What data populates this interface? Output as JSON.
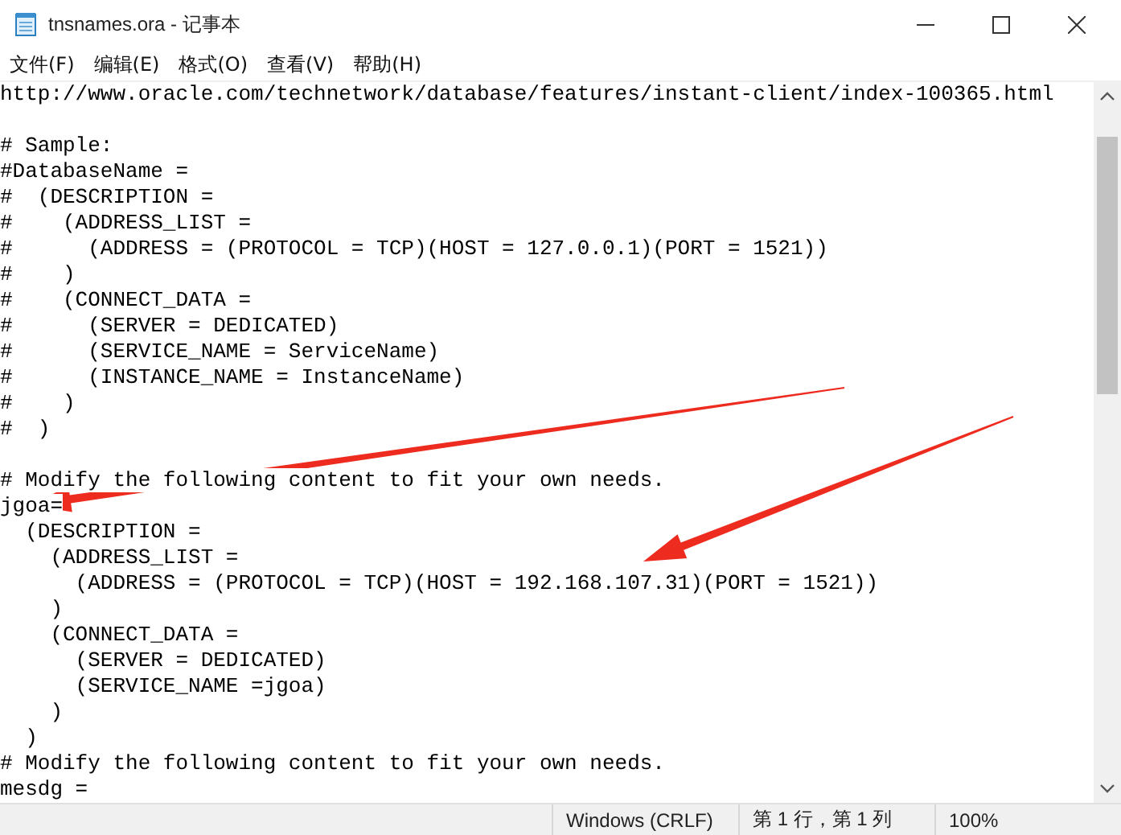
{
  "window": {
    "title": "tnsnames.ora - 记事本"
  },
  "menu": [
    {
      "label": "文件(F)"
    },
    {
      "label": "编辑(E)"
    },
    {
      "label": "格式(O)"
    },
    {
      "label": "查看(V)"
    },
    {
      "label": "帮助(H)"
    }
  ],
  "lines": [
    {
      "kind": "text",
      "text": "http://www.oracle.com/technetwork/database/features/instant-client/index-100365.html"
    },
    {
      "kind": "blank"
    },
    {
      "kind": "text",
      "text": "# Sample:"
    },
    {
      "kind": "text",
      "text": "#DatabaseName ="
    },
    {
      "kind": "text",
      "text": "#  (DESCRIPTION ="
    },
    {
      "kind": "text",
      "text": "#    (ADDRESS_LIST ="
    },
    {
      "kind": "text",
      "text": "#      (ADDRESS = (PROTOCOL = TCP)(HOST = 127.0.0.1)(PORT = 1521))"
    },
    {
      "kind": "text",
      "text": "#    )"
    },
    {
      "kind": "text",
      "text": "#    (CONNECT_DATA ="
    },
    {
      "kind": "text",
      "text": "#      (SERVER = DEDICATED)"
    },
    {
      "kind": "text",
      "text": "#      (SERVICE_NAME = ServiceName)"
    },
    {
      "kind": "text",
      "text": "#      (INSTANCE_NAME = InstanceName)"
    },
    {
      "kind": "text",
      "text": "#    )"
    },
    {
      "kind": "text",
      "text": "#  )"
    },
    {
      "kind": "blank"
    },
    {
      "kind": "text",
      "text": "# Modify the following content to fit your own needs."
    },
    {
      "kind": "text",
      "text": "jgoa="
    },
    {
      "kind": "text",
      "text": "  (DESCRIPTION ="
    },
    {
      "kind": "text",
      "text": "    (ADDRESS_LIST ="
    },
    {
      "kind": "text",
      "text": "      (ADDRESS = (PROTOCOL = TCP)(HOST = 192.168.107.31)(PORT = 1521))"
    },
    {
      "kind": "text",
      "text": "    )"
    },
    {
      "kind": "text",
      "text": "    (CONNECT_DATA ="
    },
    {
      "kind": "text",
      "text": "      (SERVER = DEDICATED)"
    },
    {
      "kind": "text",
      "text": "      (SERVICE_NAME =jgoa)"
    },
    {
      "kind": "text",
      "text": "    )"
    },
    {
      "kind": "text",
      "text": "  )"
    },
    {
      "kind": "text",
      "text": "# Modify the following content to fit your own needs."
    },
    {
      "kind": "text",
      "text": "mesdg ="
    }
  ],
  "annotations": [
    {
      "kind": "arrow"
    },
    {
      "kind": "arrow"
    }
  ],
  "status_bar": [
    {
      "text": "Windows (CRLF)"
    },
    {
      "text": "第 1 行，第 1 列"
    },
    {
      "text": "100%"
    }
  ]
}
